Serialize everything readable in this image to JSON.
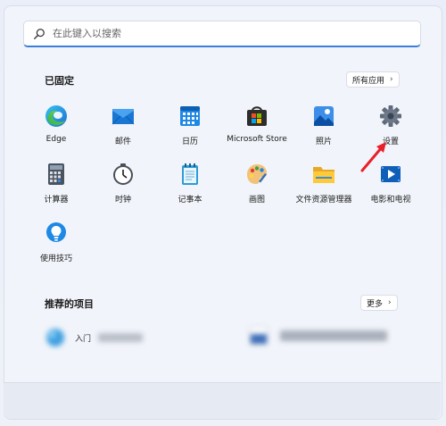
{
  "search": {
    "placeholder": "在此键入以搜索"
  },
  "pinned": {
    "title": "已固定",
    "all_apps_label": "所有应用",
    "apps": [
      {
        "label": "Edge",
        "icon": "edge-icon"
      },
      {
        "label": "邮件",
        "icon": "mail-icon"
      },
      {
        "label": "日历",
        "icon": "calendar-icon"
      },
      {
        "label": "Microsoft Store",
        "icon": "store-icon"
      },
      {
        "label": "照片",
        "icon": "photos-icon"
      },
      {
        "label": "设置",
        "icon": "gear-icon"
      },
      {
        "label": "计算器",
        "icon": "calculator-icon"
      },
      {
        "label": "时钟",
        "icon": "clock-icon"
      },
      {
        "label": "记事本",
        "icon": "notepad-icon"
      },
      {
        "label": "画图",
        "icon": "paint-icon"
      },
      {
        "label": "文件资源管理器",
        "icon": "folder-icon"
      },
      {
        "label": "电影和电视",
        "icon": "movies-icon"
      },
      {
        "label": "使用技巧",
        "icon": "tips-icon"
      }
    ]
  },
  "recommended": {
    "title": "推荐的项目",
    "more_label": "更多",
    "items": [
      {
        "label": "入门"
      }
    ]
  },
  "colors": {
    "accent": "#3b7ddd",
    "arrow": "#e8202a"
  }
}
